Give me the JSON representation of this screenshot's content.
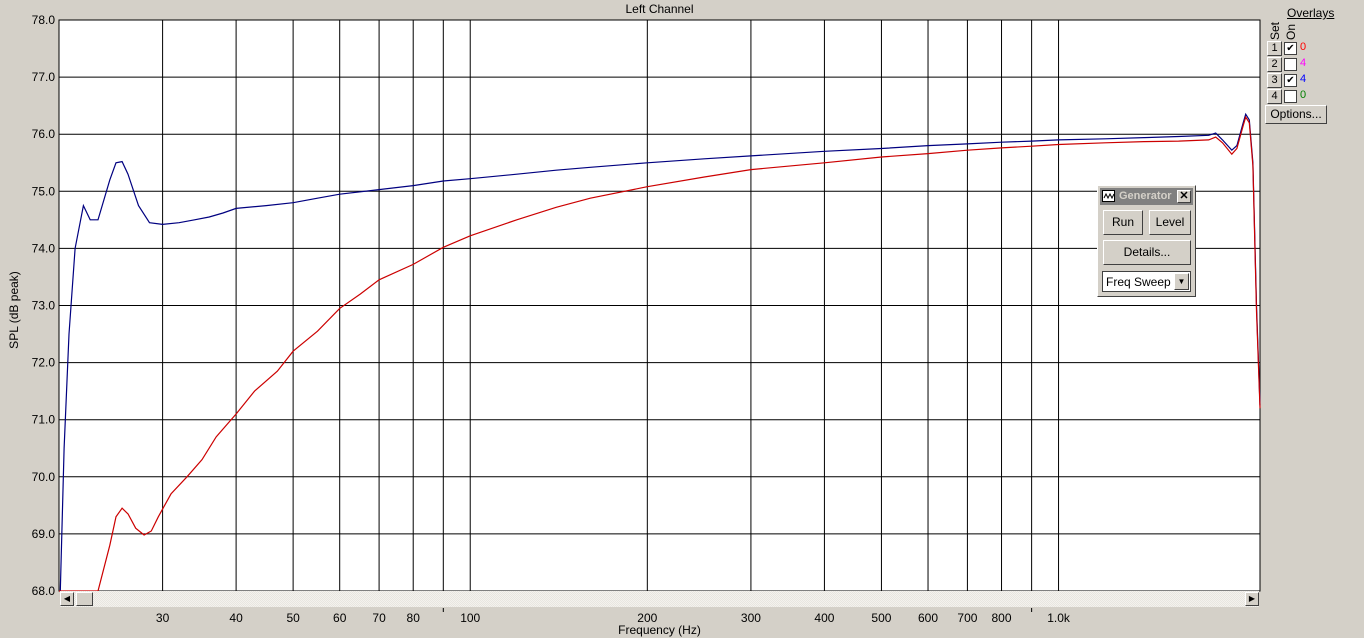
{
  "chart_data": {
    "type": "line",
    "title": "Left Channel",
    "xlabel": "Frequency (Hz)",
    "ylabel": "SPL (dB peak)",
    "x_scale": "log",
    "xlim": [
      20,
      2200
    ],
    "ylim": [
      68.0,
      78.0
    ],
    "grid": true,
    "yticks": [
      "68.0",
      "69.0",
      "70.0",
      "71.0",
      "72.0",
      "73.0",
      "74.0",
      "75.0",
      "76.0",
      "77.0",
      "78.0"
    ],
    "xticks": [
      {
        "value": 30,
        "label": "30"
      },
      {
        "value": 40,
        "label": "40"
      },
      {
        "value": 50,
        "label": "50"
      },
      {
        "value": 60,
        "label": "60"
      },
      {
        "value": 70,
        "label": "70"
      },
      {
        "value": 80,
        "label": "80"
      },
      {
        "value": 90,
        "label": ""
      },
      {
        "value": 100,
        "label": "100"
      },
      {
        "value": 200,
        "label": "200"
      },
      {
        "value": 300,
        "label": "300"
      },
      {
        "value": 400,
        "label": "400"
      },
      {
        "value": 500,
        "label": "500"
      },
      {
        "value": 600,
        "label": "600"
      },
      {
        "value": 700,
        "label": "700"
      },
      {
        "value": 800,
        "label": "800"
      },
      {
        "value": 900,
        "label": ""
      },
      {
        "value": 1000,
        "label": "1.0k"
      }
    ],
    "series": [
      {
        "color": "#000080",
        "points": [
          [
            20.1,
            68.0
          ],
          [
            20.4,
            70.5
          ],
          [
            20.8,
            72.5
          ],
          [
            21.3,
            74.0
          ],
          [
            22,
            74.75
          ],
          [
            22.6,
            74.5
          ],
          [
            23.3,
            74.5
          ],
          [
            24.4,
            75.2
          ],
          [
            25,
            75.5
          ],
          [
            25.6,
            75.52
          ],
          [
            26.2,
            75.3
          ],
          [
            27.3,
            74.75
          ],
          [
            28.5,
            74.45
          ],
          [
            30,
            74.42
          ],
          [
            32,
            74.45
          ],
          [
            34,
            74.5
          ],
          [
            36,
            74.55
          ],
          [
            38,
            74.62
          ],
          [
            40,
            74.7
          ],
          [
            45,
            74.75
          ],
          [
            50,
            74.8
          ],
          [
            55,
            74.88
          ],
          [
            60,
            74.95
          ],
          [
            70,
            75.03
          ],
          [
            80,
            75.1
          ],
          [
            90,
            75.18
          ],
          [
            100,
            75.22
          ],
          [
            120,
            75.3
          ],
          [
            140,
            75.37
          ],
          [
            160,
            75.42
          ],
          [
            200,
            75.5
          ],
          [
            250,
            75.57
          ],
          [
            300,
            75.62
          ],
          [
            400,
            75.7
          ],
          [
            500,
            75.75
          ],
          [
            600,
            75.8
          ],
          [
            700,
            75.83
          ],
          [
            800,
            75.86
          ],
          [
            900,
            75.88
          ],
          [
            1000,
            75.9
          ],
          [
            1200,
            75.92
          ],
          [
            1400,
            75.94
          ],
          [
            1600,
            75.96
          ],
          [
            1800,
            75.98
          ],
          [
            1850,
            76.02
          ],
          [
            1900,
            75.9
          ],
          [
            1970,
            75.72
          ],
          [
            2010,
            75.8
          ],
          [
            2060,
            76.2
          ],
          [
            2080,
            76.35
          ],
          [
            2110,
            76.25
          ],
          [
            2140,
            75.5
          ],
          [
            2170,
            73.0
          ],
          [
            2200,
            71.25
          ]
        ]
      },
      {
        "color": "#cc0000",
        "points": [
          [
            20,
            68.0
          ],
          [
            23.3,
            68.0
          ],
          [
            24.4,
            68.8
          ],
          [
            25,
            69.3
          ],
          [
            25.6,
            69.45
          ],
          [
            26.2,
            69.35
          ],
          [
            27,
            69.1
          ],
          [
            27.9,
            68.98
          ],
          [
            28.7,
            69.05
          ],
          [
            29.5,
            69.3
          ],
          [
            31,
            69.7
          ],
          [
            33,
            70.0
          ],
          [
            35,
            70.3
          ],
          [
            37,
            70.7
          ],
          [
            40,
            71.1
          ],
          [
            43,
            71.5
          ],
          [
            47,
            71.85
          ],
          [
            50,
            72.2
          ],
          [
            55,
            72.55
          ],
          [
            60,
            72.95
          ],
          [
            65,
            73.2
          ],
          [
            70,
            73.45
          ],
          [
            80,
            73.72
          ],
          [
            90,
            74.02
          ],
          [
            100,
            74.22
          ],
          [
            120,
            74.5
          ],
          [
            140,
            74.72
          ],
          [
            160,
            74.88
          ],
          [
            200,
            75.08
          ],
          [
            250,
            75.25
          ],
          [
            300,
            75.38
          ],
          [
            400,
            75.5
          ],
          [
            500,
            75.6
          ],
          [
            600,
            75.66
          ],
          [
            700,
            75.72
          ],
          [
            800,
            75.76
          ],
          [
            900,
            75.79
          ],
          [
            1000,
            75.82
          ],
          [
            1200,
            75.85
          ],
          [
            1400,
            75.87
          ],
          [
            1600,
            75.88
          ],
          [
            1800,
            75.9
          ],
          [
            1850,
            75.95
          ],
          [
            1900,
            75.85
          ],
          [
            1970,
            75.65
          ],
          [
            2010,
            75.75
          ],
          [
            2060,
            76.15
          ],
          [
            2080,
            76.3
          ],
          [
            2110,
            76.2
          ],
          [
            2140,
            75.45
          ],
          [
            2170,
            72.9
          ],
          [
            2200,
            71.2
          ]
        ]
      }
    ]
  },
  "overlays": {
    "title": "Overlays",
    "col_set": "Set",
    "col_on": "On",
    "rows": [
      {
        "num": "1",
        "checked": true,
        "value": "0",
        "color": "#ff0000"
      },
      {
        "num": "2",
        "checked": false,
        "value": "4",
        "color": "#ff00ff"
      },
      {
        "num": "3",
        "checked": true,
        "value": "4",
        "color": "#0000ff"
      },
      {
        "num": "4",
        "checked": false,
        "value": "0",
        "color": "#008000"
      }
    ],
    "options_label": "Options..."
  },
  "generator": {
    "title": "Generator",
    "run_label": "Run",
    "level_label": "Level",
    "details_label": "Details...",
    "mode_value": "Freq Sweep"
  },
  "scrollbar": {
    "left_arrow": "◀",
    "right_arrow": "▶"
  }
}
